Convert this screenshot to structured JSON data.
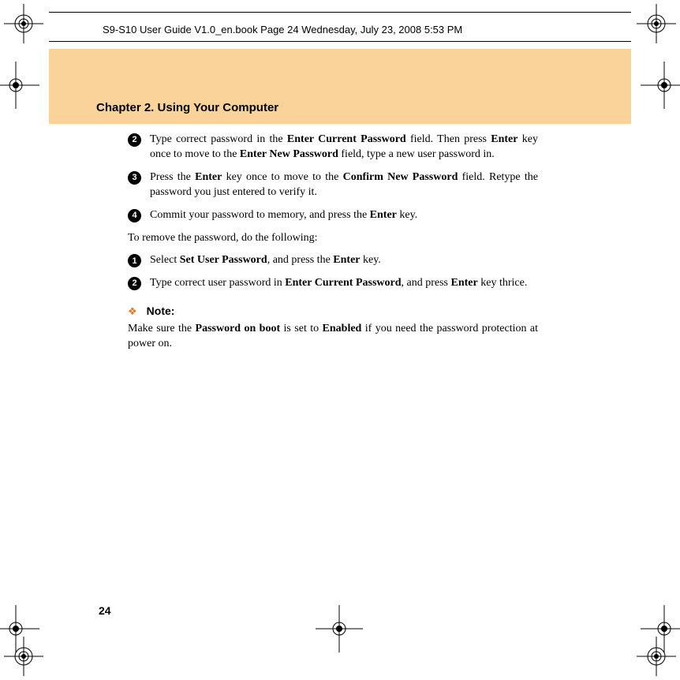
{
  "header": {
    "text": "S9-S10 User Guide V1.0_en.book  Page 24  Wednesday, July 23, 2008  5:53 PM"
  },
  "chapter": {
    "title": "Chapter 2. Using Your Computer"
  },
  "steps_a": [
    {
      "num": "2",
      "pre": "Type correct password in the ",
      "b1": "Enter Current Password",
      "mid1": " field. Then press ",
      "b2": "Enter",
      "mid2": " key once to move to the ",
      "b3": "Enter New Password",
      "post": " field, type a new user password in."
    },
    {
      "num": "3",
      "pre": "Press the ",
      "b1": "Enter",
      "mid1": " key once to move to the ",
      "b2": "Confirm New Password",
      "mid2": " field. Retype the password you just entered to verify it.",
      "b3": "",
      "post": ""
    },
    {
      "num": "4",
      "pre": "Commit your password to memory, and press the ",
      "b1": "Enter",
      "mid1": " key.",
      "b2": "",
      "mid2": "",
      "b3": "",
      "post": ""
    }
  ],
  "intro": "To remove the password, do the following:",
  "steps_b": [
    {
      "num": "1",
      "pre": "Select ",
      "b1": "Set User Password",
      "mid1": ", and press the ",
      "b2": "Enter",
      "mid2": " key.",
      "b3": "",
      "post": ""
    },
    {
      "num": "2",
      "pre": "Type correct user password in ",
      "b1": "Enter Current Password",
      "mid1": ", and press ",
      "b2": "Enter",
      "mid2": " key thrice.",
      "b3": "",
      "post": ""
    }
  ],
  "note": {
    "label": "Note:",
    "pre": "Make sure the ",
    "b1": "Password on boot",
    "mid1": " is set to ",
    "b2": "Enabled",
    "post": " if you need the password protection at power on."
  },
  "page_number": "24"
}
